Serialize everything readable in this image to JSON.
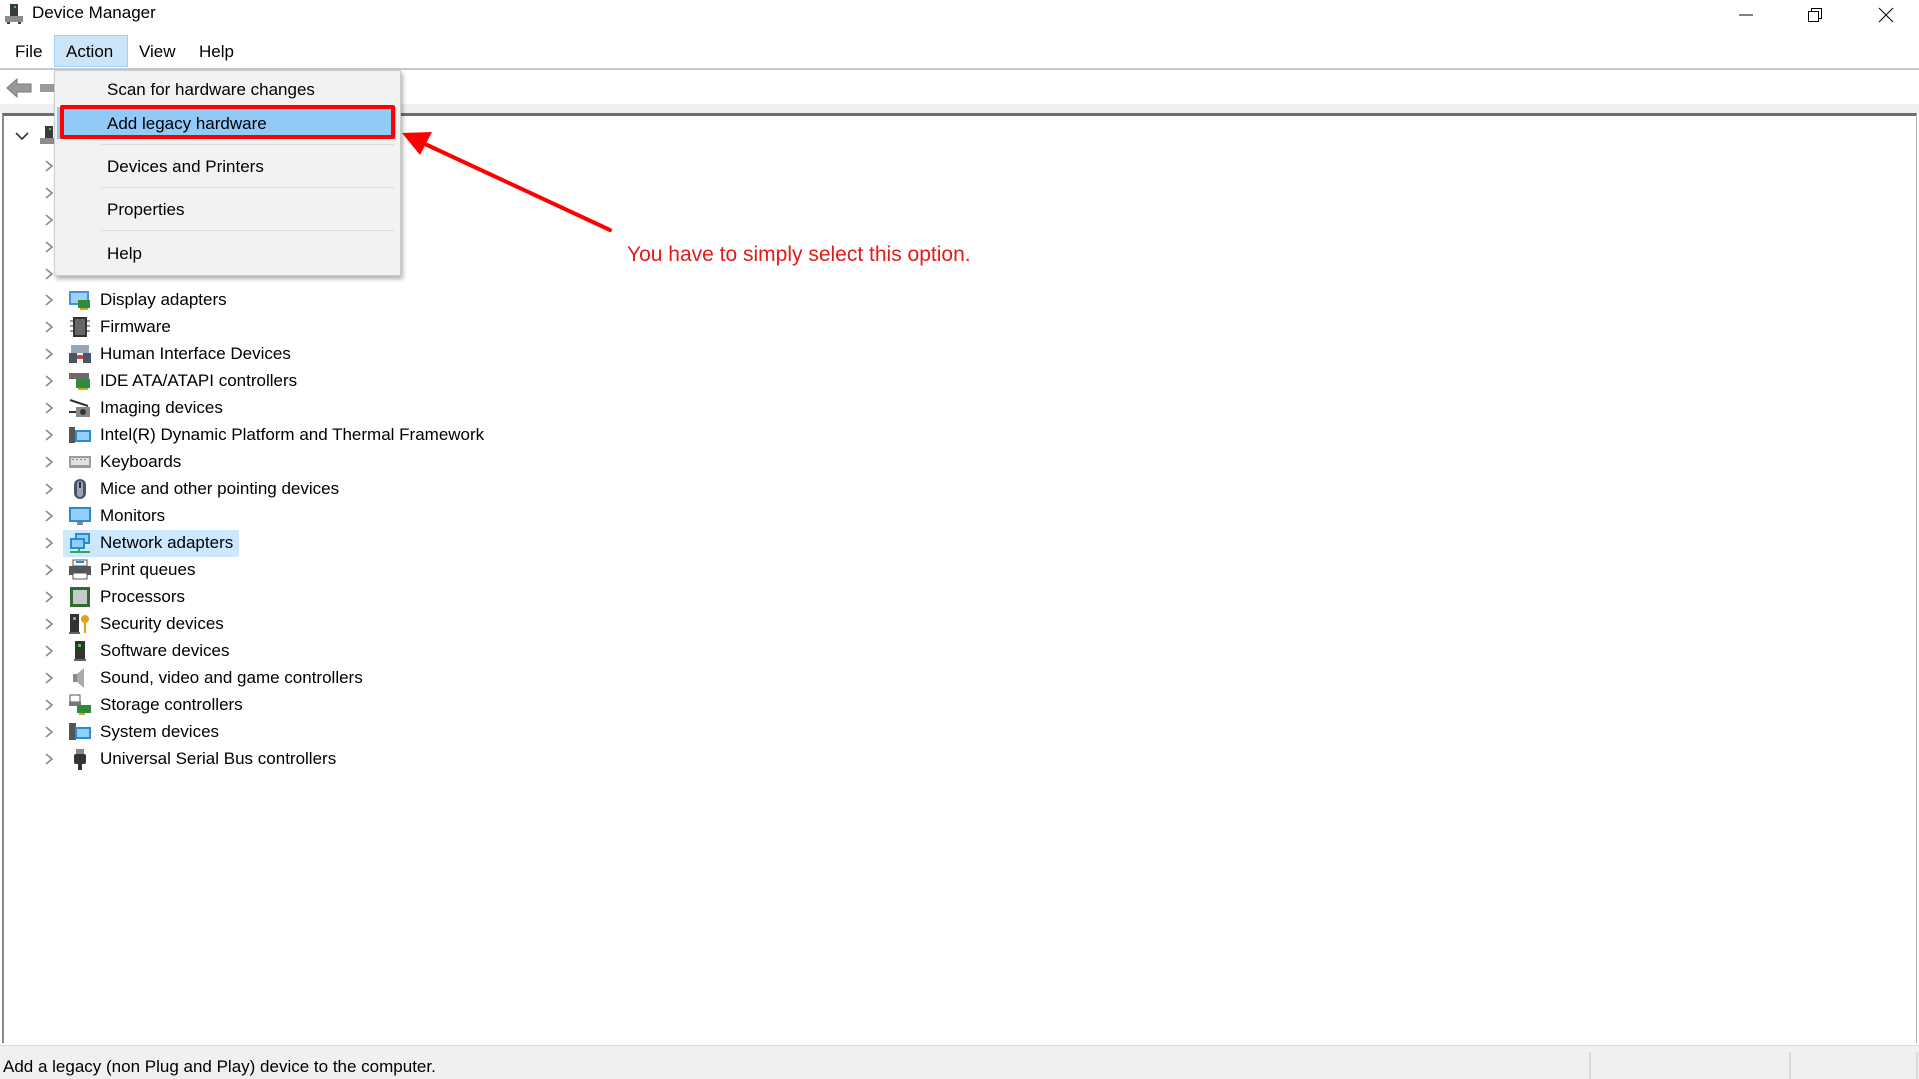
{
  "window": {
    "title": "Device Manager",
    "controls": {
      "minimize": "minimize-icon",
      "restore": "restore-icon",
      "close": "close-icon"
    }
  },
  "menubar": {
    "items": [
      "File",
      "Action",
      "View",
      "Help"
    ],
    "active": "Action"
  },
  "toolbar": {
    "buttons": [
      "back-arrow-icon",
      "toolbar-icon"
    ]
  },
  "action_menu": {
    "items": [
      {
        "label": "Scan for hardware changes",
        "highlighted": false
      },
      {
        "label": "Add legacy hardware",
        "highlighted": true
      },
      {
        "label": "Devices and Printers",
        "highlighted": false
      },
      {
        "label": "Properties",
        "highlighted": false
      },
      {
        "label": "Help",
        "highlighted": false
      }
    ]
  },
  "tree": {
    "root_expanded": true,
    "hidden_rows_count": 5,
    "items": [
      {
        "label": "Display adapters",
        "icon": "display-adapter-icon"
      },
      {
        "label": "Firmware",
        "icon": "firmware-chip-icon"
      },
      {
        "label": "Human Interface Devices",
        "icon": "hid-icon"
      },
      {
        "label": "IDE ATA/ATAPI controllers",
        "icon": "ide-controller-icon"
      },
      {
        "label": "Imaging devices",
        "icon": "camera-icon"
      },
      {
        "label": "Intel(R) Dynamic Platform and Thermal Framework",
        "icon": "computer-icon"
      },
      {
        "label": "Keyboards",
        "icon": "keyboard-icon"
      },
      {
        "label": "Mice and other pointing devices",
        "icon": "mouse-icon"
      },
      {
        "label": "Monitors",
        "icon": "monitor-icon"
      },
      {
        "label": "Network adapters",
        "icon": "network-adapter-icon",
        "selected": true
      },
      {
        "label": "Print queues",
        "icon": "printer-icon"
      },
      {
        "label": "Processors",
        "icon": "processor-icon"
      },
      {
        "label": "Security devices",
        "icon": "security-device-icon"
      },
      {
        "label": "Software devices",
        "icon": "software-device-icon"
      },
      {
        "label": "Sound, video and game controllers",
        "icon": "speaker-icon"
      },
      {
        "label": "Storage controllers",
        "icon": "storage-controller-icon"
      },
      {
        "label": "System devices",
        "icon": "system-device-icon"
      },
      {
        "label": "Universal Serial Bus controllers",
        "icon": "usb-icon"
      }
    ]
  },
  "statusbar": {
    "text": "Add a legacy (non Plug and Play) device to the computer."
  },
  "annotation": {
    "text": "You have to simply select this option.",
    "color": "#e21b1b",
    "highlight_color": "#ff0000"
  },
  "colors": {
    "menu_highlight": "#91c9f7",
    "selected_row": "#cce8ff",
    "active_menu": "#cce4f7"
  }
}
